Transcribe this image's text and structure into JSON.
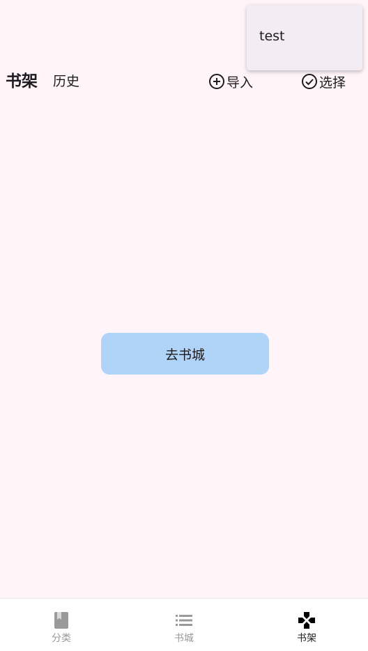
{
  "header": {
    "tabs": [
      {
        "label": "书架",
        "active": true
      },
      {
        "label": "历史",
        "active": false
      }
    ],
    "actions": {
      "import_label": "导入",
      "select_label": "选择"
    }
  },
  "popup_menu": {
    "items": [
      {
        "label": "test"
      }
    ]
  },
  "main": {
    "goto_store_label": "去书城"
  },
  "bottom_nav": {
    "items": [
      {
        "label": "分类",
        "icon": "book-icon",
        "active": false
      },
      {
        "label": "书城",
        "icon": "list-icon",
        "active": false
      },
      {
        "label": "书架",
        "icon": "gamepad-icon",
        "active": true
      }
    ]
  },
  "colors": {
    "background": "#fff5f9",
    "button": "#b0d4f7",
    "popup": "#f3ecf3",
    "inactive_nav": "#9a9a9a",
    "active_nav": "#000000"
  }
}
